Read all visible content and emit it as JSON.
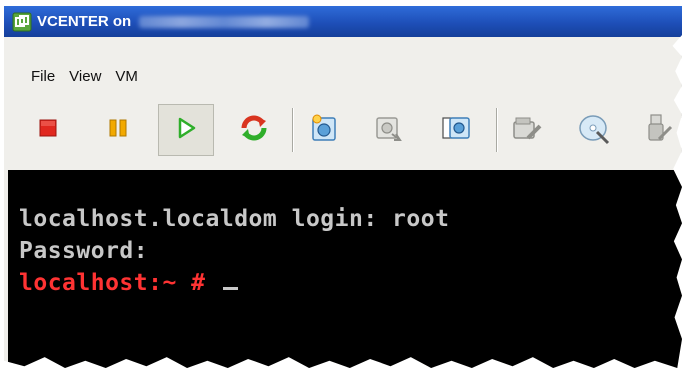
{
  "window": {
    "title": "VCENTER on"
  },
  "menu": {
    "items": [
      "File",
      "View",
      "VM"
    ]
  },
  "toolbar": {
    "buttons": [
      {
        "icon": "stop-icon",
        "color": "#e0281f"
      },
      {
        "icon": "pause-icon",
        "color": "#f2a900"
      },
      {
        "icon": "play-icon",
        "color": "#2fae2a",
        "active": true
      },
      {
        "icon": "refresh-icon",
        "color": "#d9341f"
      },
      {
        "icon": "snapshot-icon"
      },
      {
        "icon": "revert-snapshot-icon",
        "disabled": true
      },
      {
        "icon": "snapshot-manager-icon"
      },
      {
        "icon": "edit-settings-icon",
        "disabled": true
      },
      {
        "icon": "cd-dvd-icon"
      },
      {
        "icon": "usb-icon",
        "disabled": true
      }
    ]
  },
  "console": {
    "line1": "localhost.localdom login: root",
    "line2": "Password:",
    "prompt": "localhost:~ # ",
    "prompt_color": "#ff3333",
    "text_color": "#c8c8c8"
  }
}
